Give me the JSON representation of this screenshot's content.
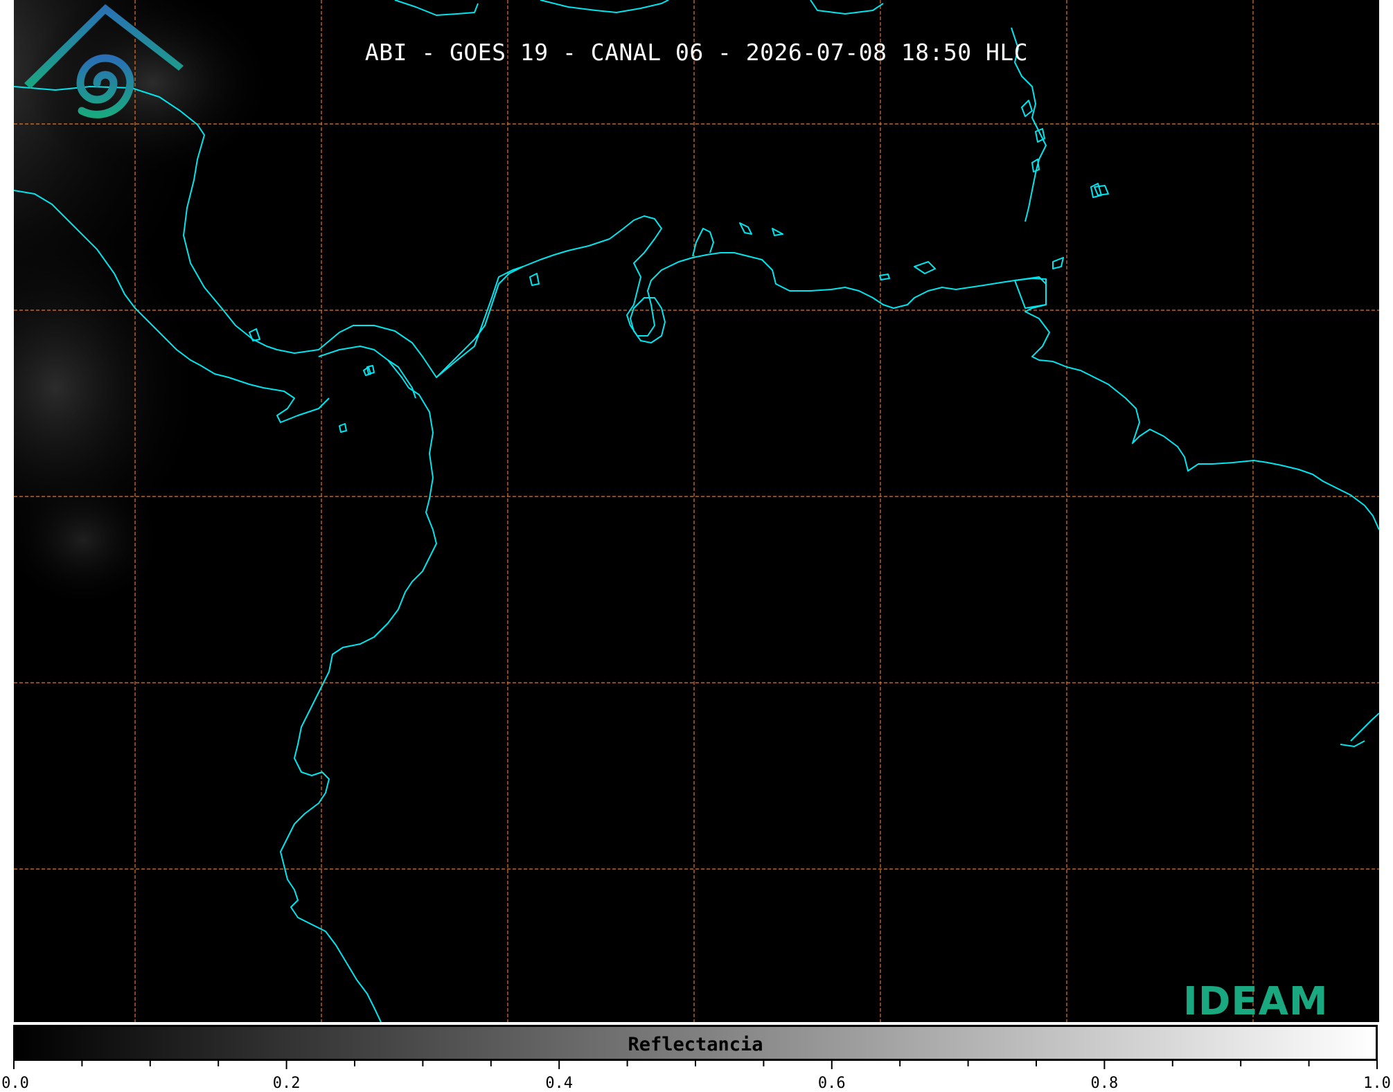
{
  "title": "ABI - GOES 19 - CANAL 06 - 2026-07-08 18:50 HLC",
  "colorbar": {
    "label": "Reflectancia",
    "min": 0.0,
    "max": 1.0,
    "ticks": [
      "0.0",
      "0.2",
      "0.4",
      "0.6",
      "0.8",
      "1.0"
    ]
  },
  "logo": {
    "text": "IDEAM"
  },
  "colors": {
    "coastline": "#00e5ee",
    "gridlines": "#e0782a",
    "background": "#000000",
    "logo_green": "#1aa880",
    "logo_blue": "#2a6fb5"
  }
}
